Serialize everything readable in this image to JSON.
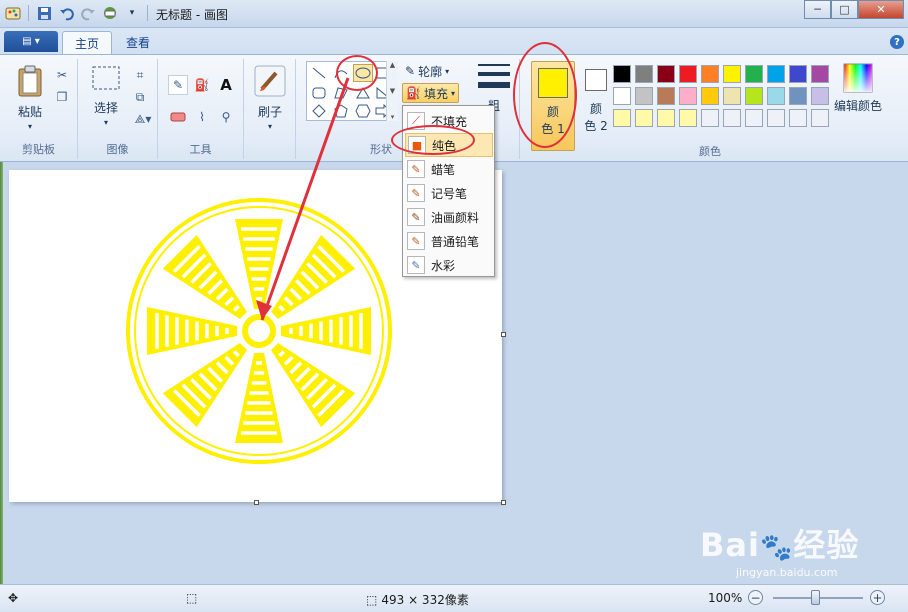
{
  "window": {
    "title": "无标题 - 画图",
    "minimize_icon": "minimize-icon",
    "maximize_icon": "maximize-icon",
    "close_icon": "close-icon"
  },
  "tabs": [
    {
      "label": "主页",
      "active": true
    },
    {
      "label": "查看",
      "active": false
    }
  ],
  "ribbon": {
    "clipboard": {
      "group_label": "剪贴板",
      "paste_label": "粘贴"
    },
    "image": {
      "group_label": "图像",
      "select_label": "选择"
    },
    "tools": {
      "group_label": "工具"
    },
    "brushes": {
      "label": "刷子"
    },
    "shapes": {
      "group_label": "形状",
      "outline_label": "轮廓",
      "fill_label": "填充"
    },
    "size": {
      "label": "粗"
    },
    "colors": {
      "group_label": "颜色",
      "color1_line1": "颜",
      "color1_line2": "色 1",
      "color2_line1": "颜",
      "color2_line2": "色 2",
      "edit_colors_label": "编辑颜色",
      "color1_value": "#ffef00",
      "color2_value": "#ffffff",
      "palette": [
        "#000000",
        "#7f7f7f",
        "#880015",
        "#ed1c24",
        "#ff7f27",
        "#fff200",
        "#22b14c",
        "#00a2e8",
        "#3f48cc",
        "#a349a4",
        "#ffffff",
        "#c3c3c3",
        "#b97a57",
        "#ffaec9",
        "#ffc90e",
        "#efe4b0",
        "#b5e61d",
        "#99d9ea",
        "#7092be",
        "#c8bfe7",
        "#fff9a8",
        "#fff9a8",
        "#fff9a8",
        "#fff9a8",
        "#eef2f8",
        "#eef2f8",
        "#eef2f8",
        "#eef2f8",
        "#eef2f8",
        "#eef2f8"
      ]
    }
  },
  "fill_menu": {
    "items": [
      {
        "label": "不填充",
        "icon": "no-fill-icon"
      },
      {
        "label": "纯色",
        "icon": "solid-color-icon",
        "highlighted": true
      },
      {
        "label": "蜡笔",
        "icon": "crayon-icon"
      },
      {
        "label": "记号笔",
        "icon": "marker-icon"
      },
      {
        "label": "油画颜料",
        "icon": "oil-paint-icon"
      },
      {
        "label": "普通铅笔",
        "icon": "pencil-icon"
      },
      {
        "label": "水彩",
        "icon": "watercolor-icon"
      }
    ]
  },
  "canvas": {
    "drawing_color": "#ffef00"
  },
  "status": {
    "size": "493 × 332像素",
    "zoom": "100%",
    "zoom_percent": 100
  },
  "watermark": {
    "brand": "Bai",
    "suffix": "经验",
    "url": "jingyan.baidu.com"
  }
}
